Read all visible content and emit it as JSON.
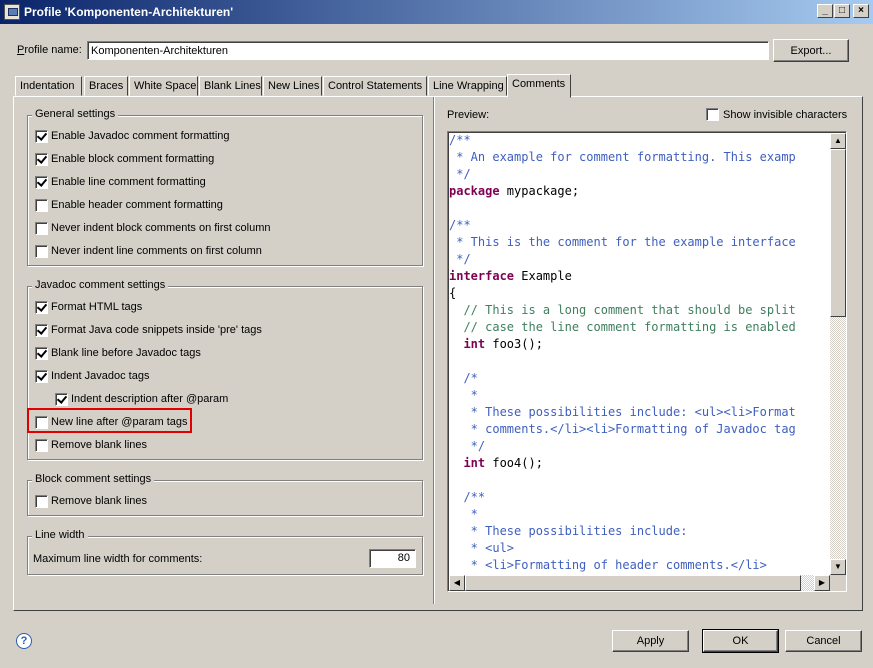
{
  "window": {
    "title": "Profile 'Komponenten-Architekturen'",
    "controls": {
      "minimize": "_",
      "maximize": "□",
      "close": "×"
    }
  },
  "profile": {
    "label": "Profile name:",
    "value": "Komponenten-Architekturen",
    "export_label": "Export..."
  },
  "tabs": [
    {
      "label": "Indentation"
    },
    {
      "label": "Braces"
    },
    {
      "label": "White Space"
    },
    {
      "label": "Blank Lines"
    },
    {
      "label": "New Lines"
    },
    {
      "label": "Control Statements"
    },
    {
      "label": "Line Wrapping"
    },
    {
      "label": "Comments",
      "active": true
    }
  ],
  "general": {
    "title": "General settings",
    "items": [
      {
        "label": "Enable Javadoc comment formatting",
        "checked": true
      },
      {
        "label": "Enable block comment formatting",
        "checked": true
      },
      {
        "label": "Enable line comment formatting",
        "checked": true
      },
      {
        "label": "Enable header comment formatting",
        "checked": false
      },
      {
        "label": "Never indent block comments on first column",
        "checked": false
      },
      {
        "label": "Never indent line comments on first column",
        "checked": false
      }
    ]
  },
  "javadoc": {
    "title": "Javadoc comment settings",
    "items": [
      {
        "label": "Format HTML tags",
        "checked": true
      },
      {
        "label": "Format Java code snippets inside 'pre' tags",
        "checked": true
      },
      {
        "label": "Blank line before Javadoc tags",
        "checked": true
      },
      {
        "label": "Indent Javadoc tags",
        "checked": true
      },
      {
        "label": "Indent description after @param",
        "checked": true
      },
      {
        "label": "New line after @param tags",
        "checked": false
      },
      {
        "label": "Remove blank lines",
        "checked": false
      }
    ]
  },
  "block": {
    "title": "Block comment settings",
    "items": [
      {
        "label": "Remove blank lines",
        "checked": false
      }
    ]
  },
  "linewidth": {
    "title": "Line width",
    "label": "Maximum line width for comments:",
    "value": "80"
  },
  "preview": {
    "label": "Preview:",
    "show_invisible_label": "Show invisible characters",
    "show_invisible_checked": false,
    "lines": [
      {
        "text": "/**",
        "kind": "comment"
      },
      {
        "text": " * An example for comment formatting. This examp",
        "kind": "comment"
      },
      {
        "text": " */",
        "kind": "comment"
      },
      {
        "kw": "package",
        "text": " mypackage;",
        "kind": "kw"
      },
      {
        "text": "",
        "kind": "plain"
      },
      {
        "text": "/**",
        "kind": "comment"
      },
      {
        "text": " * This is the comment for the example interface",
        "kind": "comment"
      },
      {
        "text": " */",
        "kind": "comment"
      },
      {
        "kw": "interface",
        "text": " Example",
        "kind": "kw"
      },
      {
        "text": "{",
        "kind": "plain"
      },
      {
        "text": "  // This is a long comment that should be split",
        "kind": "line"
      },
      {
        "text": "  // case the line comment formatting is enabled",
        "kind": "line"
      },
      {
        "kw": "  int",
        "text": " foo3();",
        "kind": "kw"
      },
      {
        "text": "",
        "kind": "plain"
      },
      {
        "text": "  /*",
        "kind": "comment"
      },
      {
        "text": "   *",
        "kind": "comment"
      },
      {
        "text": "   * These possibilities include: <ul><li>Format",
        "kind": "comment"
      },
      {
        "text": "   * comments.</li><li>Formatting of Javadoc tag",
        "kind": "comment"
      },
      {
        "text": "   */",
        "kind": "comment"
      },
      {
        "kw": "  int",
        "text": " foo4();",
        "kind": "kw"
      },
      {
        "text": "",
        "kind": "plain"
      },
      {
        "text": "  /**",
        "kind": "comment"
      },
      {
        "text": "   *",
        "kind": "comment"
      },
      {
        "text": "   * These possibilities include:",
        "kind": "comment"
      },
      {
        "text": "   * <ul>",
        "kind": "comment"
      },
      {
        "text": "   * <li>Formatting of header comments.</li>",
        "kind": "comment"
      }
    ]
  },
  "buttons": {
    "apply": "Apply",
    "ok": "OK",
    "cancel": "Cancel"
  },
  "icons": {
    "help": "?",
    "scroll_up": "▲",
    "scroll_down": "▼",
    "scroll_left": "◀",
    "scroll_right": "▶"
  }
}
